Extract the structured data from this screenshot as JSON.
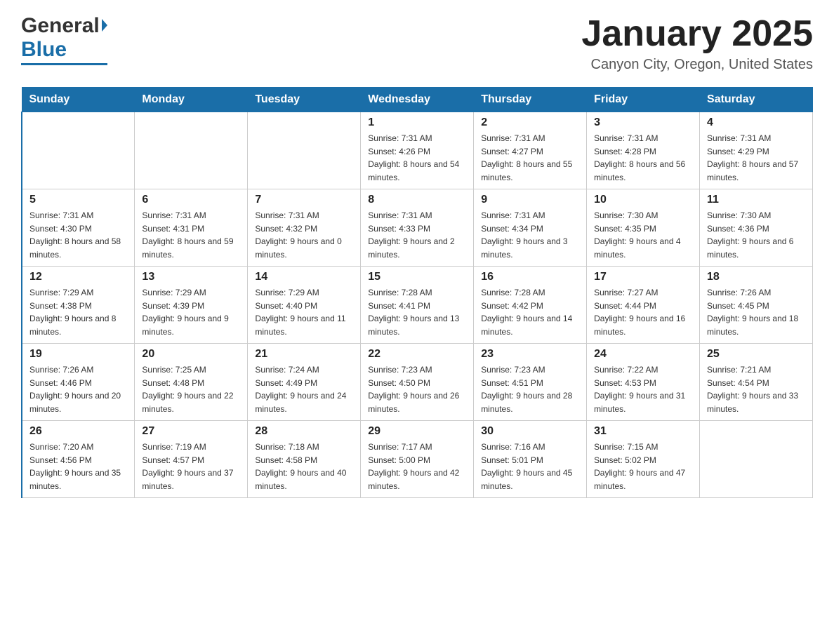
{
  "header": {
    "logo_general": "General",
    "logo_blue": "Blue",
    "title": "January 2025",
    "subtitle": "Canyon City, Oregon, United States"
  },
  "days": [
    "Sunday",
    "Monday",
    "Tuesday",
    "Wednesday",
    "Thursday",
    "Friday",
    "Saturday"
  ],
  "weeks": [
    [
      {
        "date": "",
        "sunrise": "",
        "sunset": "",
        "daylight": ""
      },
      {
        "date": "",
        "sunrise": "",
        "sunset": "",
        "daylight": ""
      },
      {
        "date": "",
        "sunrise": "",
        "sunset": "",
        "daylight": ""
      },
      {
        "date": "1",
        "sunrise": "Sunrise: 7:31 AM",
        "sunset": "Sunset: 4:26 PM",
        "daylight": "Daylight: 8 hours and 54 minutes."
      },
      {
        "date": "2",
        "sunrise": "Sunrise: 7:31 AM",
        "sunset": "Sunset: 4:27 PM",
        "daylight": "Daylight: 8 hours and 55 minutes."
      },
      {
        "date": "3",
        "sunrise": "Sunrise: 7:31 AM",
        "sunset": "Sunset: 4:28 PM",
        "daylight": "Daylight: 8 hours and 56 minutes."
      },
      {
        "date": "4",
        "sunrise": "Sunrise: 7:31 AM",
        "sunset": "Sunset: 4:29 PM",
        "daylight": "Daylight: 8 hours and 57 minutes."
      }
    ],
    [
      {
        "date": "5",
        "sunrise": "Sunrise: 7:31 AM",
        "sunset": "Sunset: 4:30 PM",
        "daylight": "Daylight: 8 hours and 58 minutes."
      },
      {
        "date": "6",
        "sunrise": "Sunrise: 7:31 AM",
        "sunset": "Sunset: 4:31 PM",
        "daylight": "Daylight: 8 hours and 59 minutes."
      },
      {
        "date": "7",
        "sunrise": "Sunrise: 7:31 AM",
        "sunset": "Sunset: 4:32 PM",
        "daylight": "Daylight: 9 hours and 0 minutes."
      },
      {
        "date": "8",
        "sunrise": "Sunrise: 7:31 AM",
        "sunset": "Sunset: 4:33 PM",
        "daylight": "Daylight: 9 hours and 2 minutes."
      },
      {
        "date": "9",
        "sunrise": "Sunrise: 7:31 AM",
        "sunset": "Sunset: 4:34 PM",
        "daylight": "Daylight: 9 hours and 3 minutes."
      },
      {
        "date": "10",
        "sunrise": "Sunrise: 7:30 AM",
        "sunset": "Sunset: 4:35 PM",
        "daylight": "Daylight: 9 hours and 4 minutes."
      },
      {
        "date": "11",
        "sunrise": "Sunrise: 7:30 AM",
        "sunset": "Sunset: 4:36 PM",
        "daylight": "Daylight: 9 hours and 6 minutes."
      }
    ],
    [
      {
        "date": "12",
        "sunrise": "Sunrise: 7:29 AM",
        "sunset": "Sunset: 4:38 PM",
        "daylight": "Daylight: 9 hours and 8 minutes."
      },
      {
        "date": "13",
        "sunrise": "Sunrise: 7:29 AM",
        "sunset": "Sunset: 4:39 PM",
        "daylight": "Daylight: 9 hours and 9 minutes."
      },
      {
        "date": "14",
        "sunrise": "Sunrise: 7:29 AM",
        "sunset": "Sunset: 4:40 PM",
        "daylight": "Daylight: 9 hours and 11 minutes."
      },
      {
        "date": "15",
        "sunrise": "Sunrise: 7:28 AM",
        "sunset": "Sunset: 4:41 PM",
        "daylight": "Daylight: 9 hours and 13 minutes."
      },
      {
        "date": "16",
        "sunrise": "Sunrise: 7:28 AM",
        "sunset": "Sunset: 4:42 PM",
        "daylight": "Daylight: 9 hours and 14 minutes."
      },
      {
        "date": "17",
        "sunrise": "Sunrise: 7:27 AM",
        "sunset": "Sunset: 4:44 PM",
        "daylight": "Daylight: 9 hours and 16 minutes."
      },
      {
        "date": "18",
        "sunrise": "Sunrise: 7:26 AM",
        "sunset": "Sunset: 4:45 PM",
        "daylight": "Daylight: 9 hours and 18 minutes."
      }
    ],
    [
      {
        "date": "19",
        "sunrise": "Sunrise: 7:26 AM",
        "sunset": "Sunset: 4:46 PM",
        "daylight": "Daylight: 9 hours and 20 minutes."
      },
      {
        "date": "20",
        "sunrise": "Sunrise: 7:25 AM",
        "sunset": "Sunset: 4:48 PM",
        "daylight": "Daylight: 9 hours and 22 minutes."
      },
      {
        "date": "21",
        "sunrise": "Sunrise: 7:24 AM",
        "sunset": "Sunset: 4:49 PM",
        "daylight": "Daylight: 9 hours and 24 minutes."
      },
      {
        "date": "22",
        "sunrise": "Sunrise: 7:23 AM",
        "sunset": "Sunset: 4:50 PM",
        "daylight": "Daylight: 9 hours and 26 minutes."
      },
      {
        "date": "23",
        "sunrise": "Sunrise: 7:23 AM",
        "sunset": "Sunset: 4:51 PM",
        "daylight": "Daylight: 9 hours and 28 minutes."
      },
      {
        "date": "24",
        "sunrise": "Sunrise: 7:22 AM",
        "sunset": "Sunset: 4:53 PM",
        "daylight": "Daylight: 9 hours and 31 minutes."
      },
      {
        "date": "25",
        "sunrise": "Sunrise: 7:21 AM",
        "sunset": "Sunset: 4:54 PM",
        "daylight": "Daylight: 9 hours and 33 minutes."
      }
    ],
    [
      {
        "date": "26",
        "sunrise": "Sunrise: 7:20 AM",
        "sunset": "Sunset: 4:56 PM",
        "daylight": "Daylight: 9 hours and 35 minutes."
      },
      {
        "date": "27",
        "sunrise": "Sunrise: 7:19 AM",
        "sunset": "Sunset: 4:57 PM",
        "daylight": "Daylight: 9 hours and 37 minutes."
      },
      {
        "date": "28",
        "sunrise": "Sunrise: 7:18 AM",
        "sunset": "Sunset: 4:58 PM",
        "daylight": "Daylight: 9 hours and 40 minutes."
      },
      {
        "date": "29",
        "sunrise": "Sunrise: 7:17 AM",
        "sunset": "Sunset: 5:00 PM",
        "daylight": "Daylight: 9 hours and 42 minutes."
      },
      {
        "date": "30",
        "sunrise": "Sunrise: 7:16 AM",
        "sunset": "Sunset: 5:01 PM",
        "daylight": "Daylight: 9 hours and 45 minutes."
      },
      {
        "date": "31",
        "sunrise": "Sunrise: 7:15 AM",
        "sunset": "Sunset: 5:02 PM",
        "daylight": "Daylight: 9 hours and 47 minutes."
      },
      {
        "date": "",
        "sunrise": "",
        "sunset": "",
        "daylight": ""
      }
    ]
  ]
}
